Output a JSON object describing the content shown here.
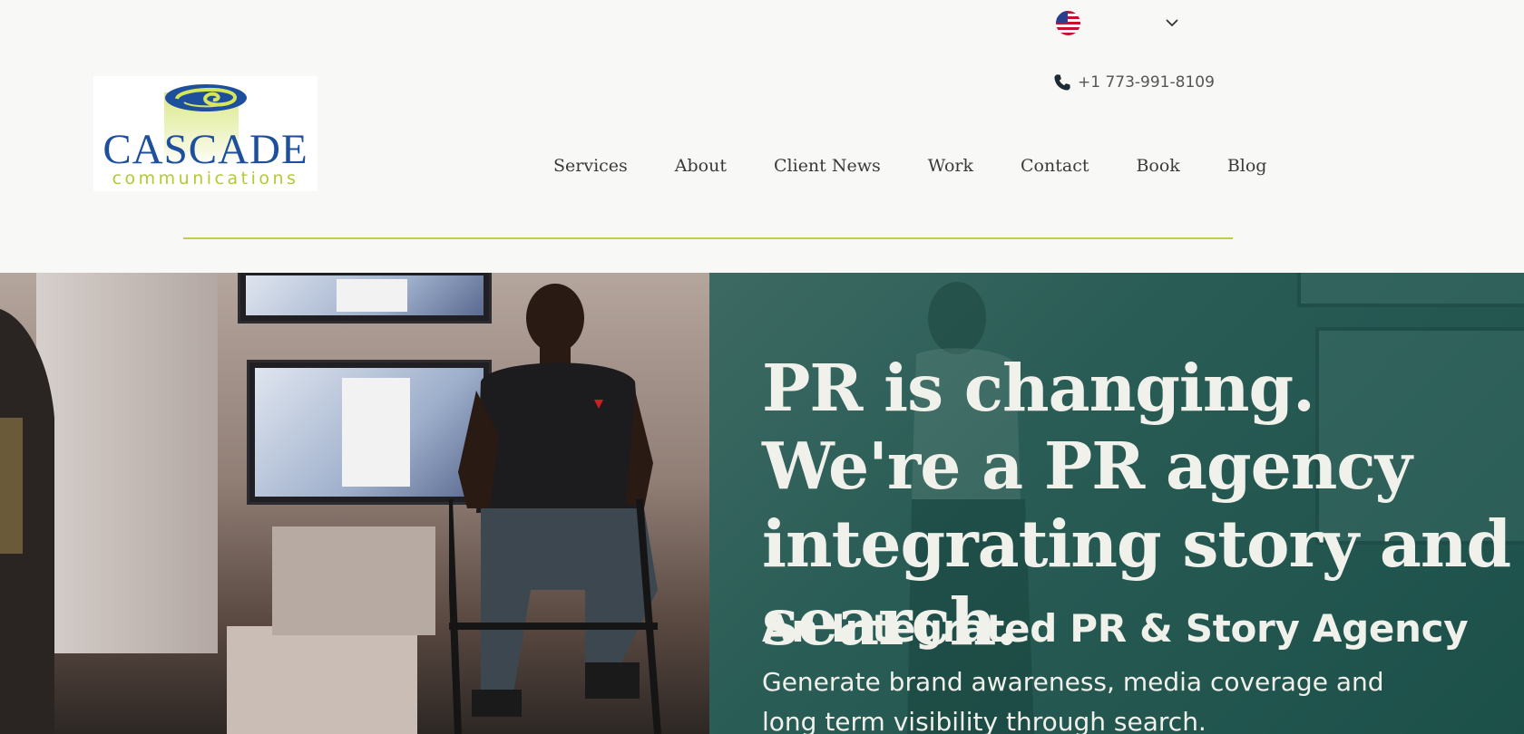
{
  "header": {
    "language_flag": "us-flag-icon",
    "phone": "+1 773-991-8109"
  },
  "logo": {
    "name": "CASCADE",
    "tagline": "communications",
    "colors": {
      "blue": "#1d4f9c",
      "lime": "#b5c930"
    }
  },
  "nav": {
    "items": [
      "Services",
      "About",
      "Client News",
      "Work",
      "Contact",
      "Book",
      "Blog"
    ]
  },
  "hero": {
    "headline": "PR is changing. We're a PR agency integrating story and search.",
    "subheadline": "An Integrated PR & Story Agency",
    "body": "Generate brand awareness, media coverage and long term visibility through search."
  },
  "colors": {
    "accent_line": "#c3cb4c",
    "overlay": "#1f5a52",
    "text_light": "#f1f1ec"
  }
}
